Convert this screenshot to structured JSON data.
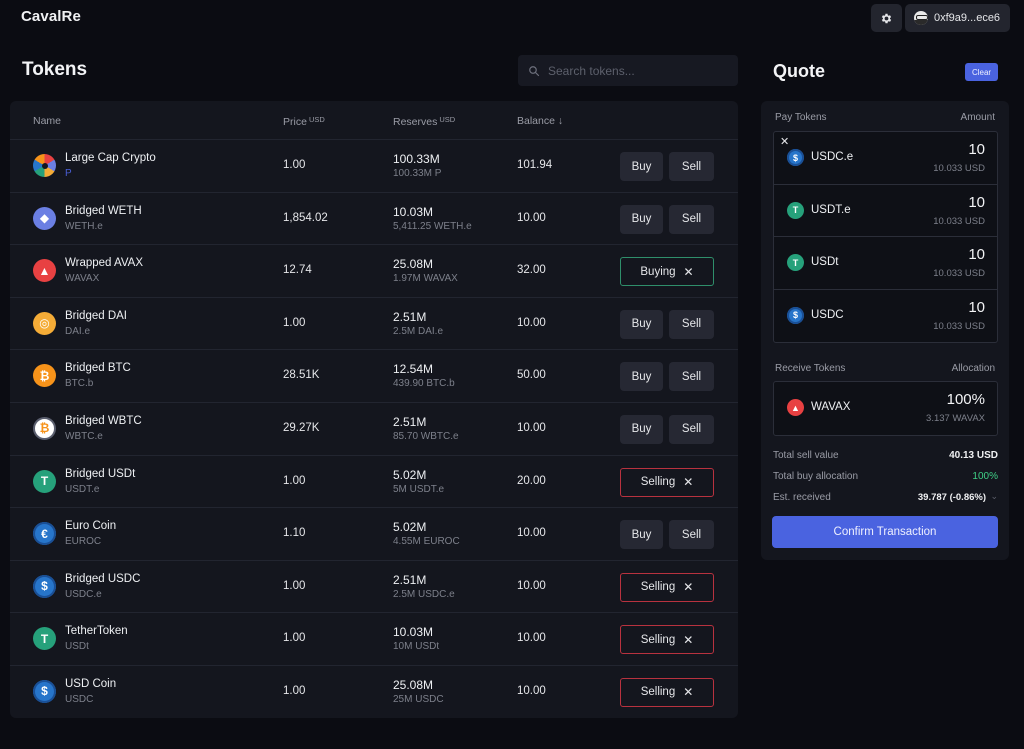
{
  "app": {
    "title": "CavalRe"
  },
  "header": {
    "wallet_address": "0xf9a9...ece6",
    "settings_icon": "gear-icon",
    "avatar_icon": "avatar-icon"
  },
  "tokens": {
    "title": "Tokens",
    "search_placeholder": "Search tokens...",
    "columns": {
      "name": "Name",
      "price": "Price",
      "price_unit": "USD",
      "reserves": "Reserves",
      "reserves_unit": "USD",
      "balance": "Balance",
      "balance_sort_icon": "↓"
    },
    "buy_label": "Buy",
    "sell_label": "Sell",
    "rows": [
      {
        "name": "Large Cap Crypto",
        "symbol": "P",
        "icon": "large-cap-crypto-icon",
        "icon_color": "multi",
        "price": "1.00",
        "reserves": "100.33M",
        "reserves_sub": "100.33M P",
        "balance": "101.94",
        "state": "none"
      },
      {
        "name": "Bridged WETH",
        "symbol": "WETH.e",
        "icon": "ethereum-icon",
        "icon_color": "#6b7fe3",
        "price": "1,854.02",
        "reserves": "10.03M",
        "reserves_sub": "5,411.25 WETH.e",
        "balance": "10.00",
        "state": "none"
      },
      {
        "name": "Wrapped AVAX",
        "symbol": "WAVAX",
        "icon": "avax-icon",
        "icon_color": "#e84142",
        "price": "12.74",
        "reserves": "25.08M",
        "reserves_sub": "1.97M WAVAX",
        "balance": "32.00",
        "state": "buying",
        "state_label": "Buying"
      },
      {
        "name": "Bridged DAI",
        "symbol": "DAI.e",
        "icon": "dai-icon",
        "icon_color": "#f5ac37",
        "price": "1.00",
        "reserves": "2.51M",
        "reserves_sub": "2.5M DAI.e",
        "balance": "10.00",
        "state": "none"
      },
      {
        "name": "Bridged BTC",
        "symbol": "BTC.b",
        "icon": "bitcoin-icon",
        "icon_color": "#f7931a",
        "price": "28.51K",
        "reserves": "12.54M",
        "reserves_sub": "439.90 BTC.b",
        "balance": "50.00",
        "state": "none"
      },
      {
        "name": "Bridged WBTC",
        "symbol": "WBTC.e",
        "icon": "wbtc-icon",
        "icon_color": "#ffffff",
        "price": "29.27K",
        "reserves": "2.51M",
        "reserves_sub": "85.70 WBTC.e",
        "balance": "10.00",
        "state": "none"
      },
      {
        "name": "Bridged USDt",
        "symbol": "USDT.e",
        "icon": "tether-icon",
        "icon_color": "#26a17b",
        "price": "1.00",
        "reserves": "5.02M",
        "reserves_sub": "5M USDT.e",
        "balance": "20.00",
        "state": "selling",
        "state_label": "Selling"
      },
      {
        "name": "Euro Coin",
        "symbol": "EUROC",
        "icon": "euro-coin-icon",
        "icon_color": "#2775ca",
        "price": "1.10",
        "reserves": "5.02M",
        "reserves_sub": "4.55M EUROC",
        "balance": "10.00",
        "state": "none"
      },
      {
        "name": "Bridged USDC",
        "symbol": "USDC.e",
        "icon": "usdc-icon",
        "icon_color": "#2775ca",
        "price": "1.00",
        "reserves": "2.51M",
        "reserves_sub": "2.5M USDC.e",
        "balance": "10.00",
        "state": "selling",
        "state_label": "Selling"
      },
      {
        "name": "TetherToken",
        "symbol": "USDt",
        "icon": "tether-icon",
        "icon_color": "#26a17b",
        "price": "1.00",
        "reserves": "10.03M",
        "reserves_sub": "10M USDt",
        "balance": "10.00",
        "state": "selling",
        "state_label": "Selling"
      },
      {
        "name": "USD Coin",
        "symbol": "USDC",
        "icon": "usdc-icon",
        "icon_color": "#2775ca",
        "price": "1.00",
        "reserves": "25.08M",
        "reserves_sub": "25M USDC",
        "balance": "10.00",
        "state": "selling",
        "state_label": "Selling"
      }
    ]
  },
  "quote": {
    "title": "Quote",
    "clear_label": "Clear",
    "pay_label": "Pay Tokens",
    "amount_label": "Amount",
    "pay_tokens": [
      {
        "symbol": "USDC.e",
        "icon": "usdc-icon",
        "icon_color": "#2775ca",
        "amount": "10",
        "usd": "10.033 USD"
      },
      {
        "symbol": "USDT.e",
        "icon": "tether-icon",
        "icon_color": "#26a17b",
        "amount": "10",
        "usd": "10.033 USD"
      },
      {
        "symbol": "USDt",
        "icon": "tether-icon",
        "icon_color": "#26a17b",
        "amount": "10",
        "usd": "10.033 USD"
      },
      {
        "symbol": "USDC",
        "icon": "usdc-icon",
        "icon_color": "#2775ca",
        "amount": "10",
        "usd": "10.033 USD"
      }
    ],
    "receive_label": "Receive Tokens",
    "allocation_label": "Allocation",
    "receive_tokens": [
      {
        "symbol": "WAVAX",
        "icon": "avax-icon",
        "icon_color": "#e84142",
        "allocation": "100%",
        "amount": "3.137 WAVAX"
      }
    ],
    "summary": {
      "total_sell_label": "Total sell value",
      "total_sell_value": "40.13 USD",
      "total_buy_label": "Total buy allocation",
      "total_buy_value": "100%",
      "est_label": "Est. received",
      "est_value": "39.787 (-0.86%)"
    },
    "confirm_label": "Confirm Transaction"
  },
  "colors": {
    "accent": "#4a63e0",
    "buying_border": "#2f8f6b",
    "selling_border": "#b8323f",
    "positive": "#3fcf86",
    "background": "#0b0c12",
    "panel": "#14161e"
  }
}
